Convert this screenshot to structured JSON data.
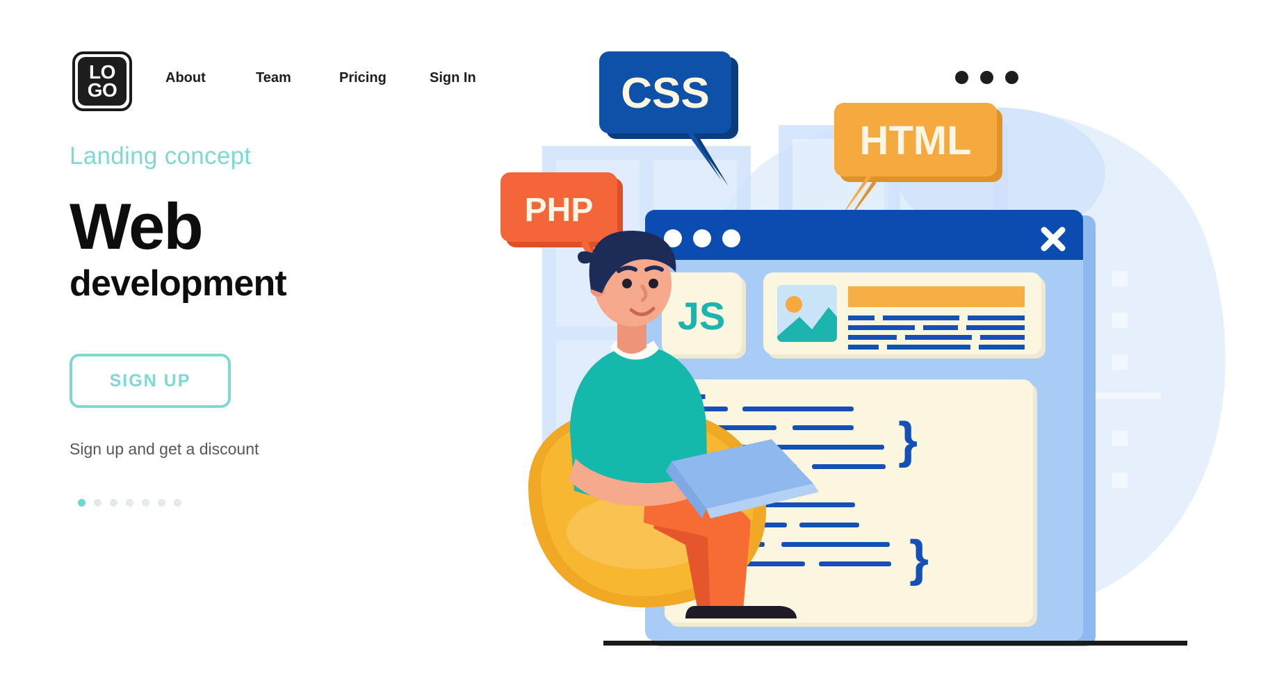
{
  "header": {
    "logo": {
      "line1": "LO",
      "line2": "GO",
      "name": "logo"
    },
    "nav": [
      {
        "label": "About"
      },
      {
        "label": "Team"
      },
      {
        "label": "Pricing"
      },
      {
        "label": "Sign In"
      }
    ],
    "kebab_dots": 3
  },
  "hero": {
    "eyebrow": "Landing concept",
    "title_main": "Web",
    "title_sub": "development",
    "cta_label": "SIGN UP",
    "note": "Sign up and get a discount",
    "pager": {
      "total": 7,
      "active_index": 0
    }
  },
  "illustration": {
    "bubbles": [
      {
        "label": "CSS",
        "color": "#0D52A8",
        "shadow": "#0A3C7E",
        "text_color": "#FCF6E3"
      },
      {
        "label": "HTML",
        "color": "#F5A93F",
        "shadow": "#E09226",
        "text_color": "#FCF6E3"
      },
      {
        "label": "PHP",
        "color": "#F4653A",
        "shadow": "#E04E28",
        "text_color": "#FCF6E3"
      }
    ],
    "browser": {
      "titlebar_color": "#0B4CB0",
      "body_color": "#A9CCF6",
      "dots": 3,
      "close_icon": "✕",
      "cards": [
        {
          "label": "JS",
          "color": "#1CB4AC"
        },
        {
          "label": "image-preview"
        }
      ]
    },
    "code_panel": {
      "bg": "#FBF6E0",
      "line_color": "#1450B5",
      "braces": [
        "{",
        "}",
        "}"
      ]
    },
    "character": {
      "hair": "#1C2C57",
      "skin": "#F6A98C",
      "sweater": "#14B9AC",
      "pants": "#F76B35",
      "shoes": "#1E1B26",
      "beanbag": "#F7B731",
      "laptop": "#8FB8EE"
    },
    "colors": {
      "background_blob": "#E3EEFC",
      "window_frame": "#CFE2FB",
      "ground_line": "#1A1A1A"
    }
  }
}
